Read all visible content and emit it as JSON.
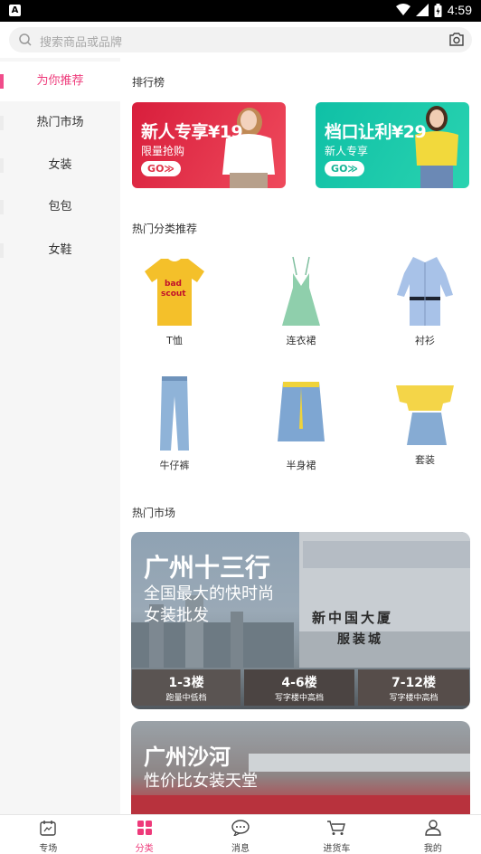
{
  "status": {
    "time": "4:59",
    "app_badge": "A"
  },
  "search": {
    "placeholder": "搜索商品或品牌"
  },
  "sidebar": {
    "items": [
      {
        "label": "为你推荐"
      },
      {
        "label": "热门市场"
      },
      {
        "label": "女装"
      },
      {
        "label": "包包"
      },
      {
        "label": "女鞋"
      }
    ]
  },
  "main": {
    "ranking_title": "排行榜",
    "promos": [
      {
        "title": "新人专享¥19",
        "sub": "限量抢购",
        "go": "GO≫",
        "color": "#e03246"
      },
      {
        "title": "档口让利¥29",
        "sub": "新人专享",
        "go": "GO≫",
        "color": "#16c9a6"
      }
    ],
    "categories_title": "热门分类推荐",
    "categories": [
      {
        "label": "T恤"
      },
      {
        "label": "连衣裙"
      },
      {
        "label": "衬衫"
      },
      {
        "label": "牛仔裤"
      },
      {
        "label": "半身裙"
      },
      {
        "label": "套装"
      }
    ],
    "market_title": "热门市场",
    "markets": [
      {
        "title": "广州十三行",
        "sub1": "全国最大的快时尚",
        "sub2": "女装批发",
        "sign": "新中国大厦",
        "sign2": "服装城",
        "tags": [
          {
            "big": "1-3楼",
            "small": "跑量中低档"
          },
          {
            "big": "4-6楼",
            "small": "写字楼中高档"
          },
          {
            "big": "7-12楼",
            "small": "写字楼中高档"
          }
        ]
      },
      {
        "title": "广州沙河",
        "sub1": "性价比女装天堂"
      }
    ]
  },
  "tabbar": {
    "items": [
      {
        "label": "专场"
      },
      {
        "label": "分类"
      },
      {
        "label": "消息"
      },
      {
        "label": "进货车"
      },
      {
        "label": "我的"
      }
    ]
  },
  "colors": {
    "accent": "#ee3a7a"
  }
}
